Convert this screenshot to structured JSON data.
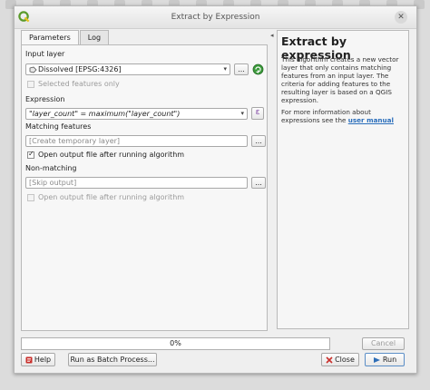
{
  "window": {
    "title": "Extract by Expression"
  },
  "tabs": [
    {
      "label": "Parameters"
    },
    {
      "label": "Log"
    }
  ],
  "input_layer": {
    "label": "Input layer",
    "value": "Dissolved [EPSG:4326]",
    "more_button": "...",
    "selected_only_label": "Selected features only"
  },
  "expression": {
    "label": "Expression",
    "value": "\"layer_count\"  =  maximum(\"layer_count\")",
    "epsilon_glyph": "ε"
  },
  "matching": {
    "label": "Matching features",
    "placeholder": "[Create temporary layer]",
    "more_button": "...",
    "open_label": "Open output file after running algorithm"
  },
  "non_matching": {
    "label": "Non-matching",
    "placeholder": "[Skip output]",
    "more_button": "...",
    "open_label": "Open output file after running algorithm"
  },
  "splitter": {
    "glyph": "◂"
  },
  "help": {
    "title": "Extract by expression",
    "p1": "This algorithm creates a new vector layer that only contains matching features from an input layer. The criteria for adding features to the resulting layer is based on a QGIS expression.",
    "p2_prefix": "For more information about expressions see the ",
    "p2_link": "user manual"
  },
  "progress": {
    "text": "0%",
    "value_percent": 0
  },
  "buttons": {
    "cancel": "Cancel",
    "help": "Help",
    "batch": "Run as Batch Process...",
    "close": "Close",
    "run": "Run"
  },
  "colors": {
    "link": "#2a6ebb",
    "accent_check": "#222222"
  }
}
